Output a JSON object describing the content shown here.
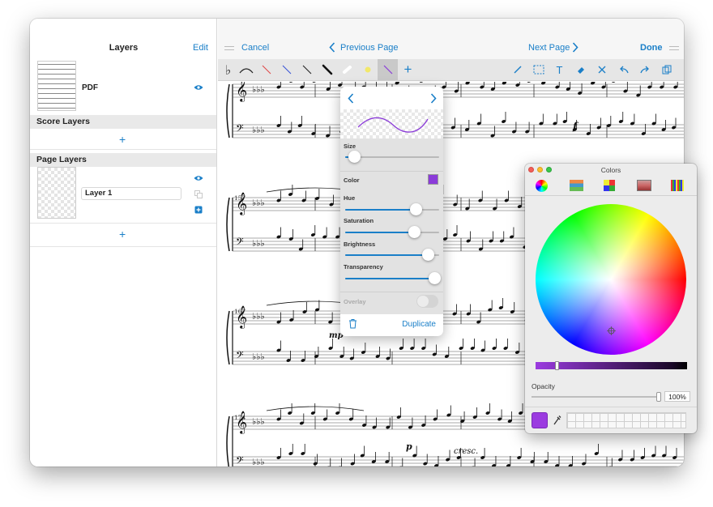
{
  "sidebar": {
    "title": "Layers",
    "edit_label": "Edit",
    "pdf_label": "PDF",
    "score_layers_header": "Score Layers",
    "page_layers_header": "Page Layers",
    "layer_name": "Layer 1"
  },
  "topbar": {
    "cancel_label": "Cancel",
    "previous_page_label": "Previous Page",
    "next_page_label": "Next Page",
    "done_label": "Done"
  },
  "toolbar": {
    "tools": [
      "flat-icon",
      "slur-icon",
      "red-line-icon",
      "blue-line-icon",
      "black-thin-line-icon",
      "black-thick-line-icon",
      "white-brush-icon",
      "yellow-highlighter-icon",
      "purple-pen-icon",
      "add-tool-icon"
    ],
    "right_tools": [
      "pencil-icon",
      "rect-select-icon",
      "text-icon",
      "eraser-icon",
      "delete-icon",
      "undo-icon",
      "redo-icon",
      "layers-icon"
    ]
  },
  "score": {
    "measure_numbers": [
      "157",
      "167",
      "174"
    ],
    "dynamics": [
      "f",
      "mp",
      "p",
      "cresc."
    ]
  },
  "brush_popover": {
    "size_label": "Size",
    "color_label": "Color",
    "hue_label": "Hue",
    "saturation_label": "Saturation",
    "brightness_label": "Brightness",
    "transparency_label": "Transparency",
    "overlay_label": "Overlay",
    "duplicate_label": "Duplicate",
    "size_value": 0.1,
    "hue_value": 0.75,
    "saturation_value": 0.74,
    "brightness_value": 0.88,
    "transparency_value": 0.95,
    "color": "#8b3bd9"
  },
  "colors_panel": {
    "title": "Colors",
    "opacity_label": "Opacity",
    "opacity_value": "100%",
    "selected_color": "#9b3be0"
  },
  "colors": {
    "accent": "#1a7fc8"
  }
}
